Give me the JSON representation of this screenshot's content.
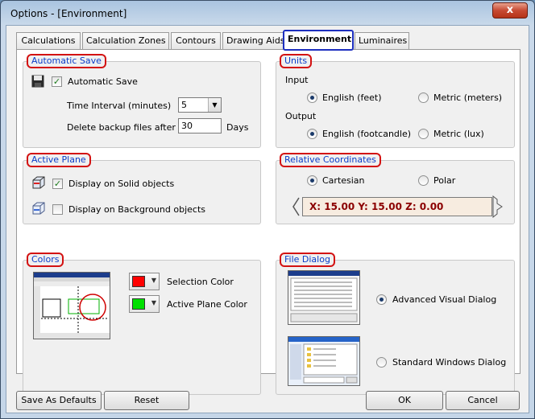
{
  "window": {
    "title": "Options - [Environment]",
    "close_glyph": "x"
  },
  "tabs": [
    {
      "label": "Calculations"
    },
    {
      "label": "Calculation Zones"
    },
    {
      "label": "Contours"
    },
    {
      "label": "Drawing Aids"
    },
    {
      "label": "Environment"
    },
    {
      "label": "Luminaires"
    }
  ],
  "auto_save": {
    "legend": "Automatic Save",
    "checkbox_label": "Automatic Save",
    "checked": true,
    "interval_label": "Time Interval (minutes)",
    "interval_value": "5",
    "delete_label": "Delete backup files after",
    "delete_value": "30",
    "delete_unit": "Days",
    "icon": "floppy-disk-icon"
  },
  "units": {
    "legend": "Units",
    "input_label": "Input",
    "input_english": "English (feet)",
    "input_metric": "Metric (meters)",
    "output_label": "Output",
    "output_english": "English (footcandle)",
    "output_metric": "Metric (lux)"
  },
  "active_plane": {
    "legend": "Active Plane",
    "solid_label": "Display on Solid objects",
    "solid_checked": true,
    "background_label": "Display on Background objects",
    "background_checked": false
  },
  "relative_coords": {
    "legend": "Relative Coordinates",
    "cartesian": "Cartesian",
    "polar": "Polar",
    "readout": "X: 15.00    Y: 15.00    Z: 0.00"
  },
  "colors": {
    "legend": "Colors",
    "selection_label": "Selection Color",
    "selection_color": "#ff0000",
    "plane_label": "Active Plane Color",
    "plane_color": "#00e000"
  },
  "file_dialog": {
    "legend": "File Dialog",
    "advanced": "Advanced Visual Dialog",
    "standard": "Standard Windows Dialog"
  },
  "buttons": {
    "save_defaults": "Save As Defaults",
    "reset": "Reset",
    "ok": "OK",
    "cancel": "Cancel"
  }
}
